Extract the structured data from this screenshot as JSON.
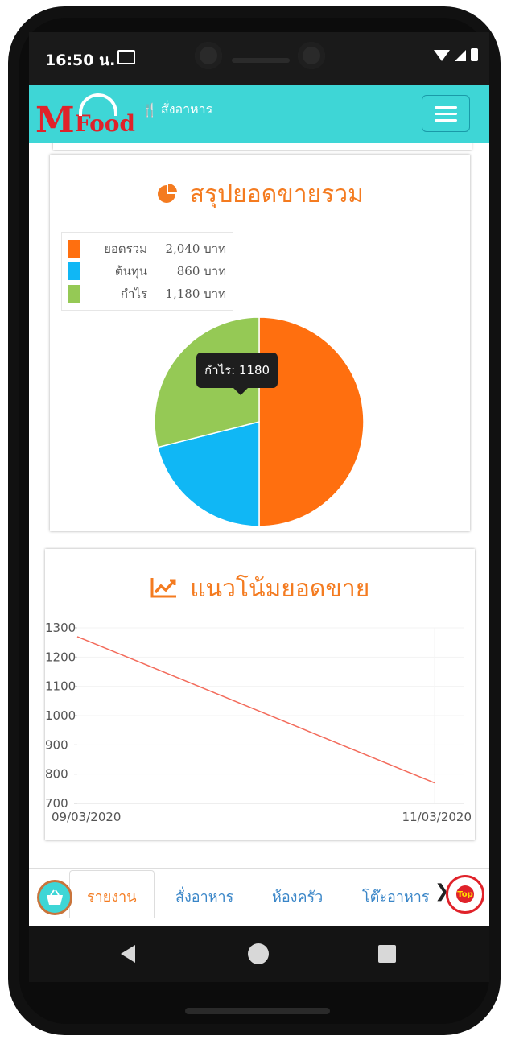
{
  "status_bar": {
    "time": "16:50 น."
  },
  "app_bar": {
    "logo_m": "M",
    "logo_food": "Food",
    "title_icon": "🍴",
    "title": "สั่งอาหาร"
  },
  "summary_card": {
    "icon": "pie-chart-icon",
    "title": "สรุปยอดขายรวม",
    "legend": [
      {
        "name": "ยอดรวม",
        "value": "2,040 บาท",
        "color": "#ff6f0f"
      },
      {
        "name": "ต้นทุน",
        "value": "860 บาท",
        "color": "#10b7f5"
      },
      {
        "name": "กำไร",
        "value": "1,180 บาท",
        "color": "#95c955"
      }
    ],
    "tooltip": "กำไร: 1180"
  },
  "trend_card": {
    "icon": "line-chart-icon",
    "title": "แนวโน้มยอดขาย"
  },
  "chart_data": [
    {
      "type": "pie",
      "labels": [
        "ยอดรวม",
        "ต้นทุน",
        "กำไร"
      ],
      "values": [
        2040,
        860,
        1180
      ],
      "colors": [
        "#ff6f0f",
        "#10b7f5",
        "#95c955"
      ],
      "legend": "top-left"
    },
    {
      "type": "line",
      "x": [
        "09/03/2020",
        "11/03/2020"
      ],
      "series": [
        {
          "values": [
            1270,
            770
          ],
          "color": "#f36b5b"
        }
      ],
      "yticks": [
        1300,
        1200,
        1100,
        1000,
        900,
        800,
        700
      ],
      "ylim": [
        700,
        1300
      ],
      "grid": true
    }
  ],
  "bottom_nav": {
    "items": [
      {
        "label": "รายงาน",
        "active": true,
        "color": "#f47b20"
      },
      {
        "label": "สั่งอาหาร"
      },
      {
        "label": "ห้องครัว"
      },
      {
        "label": "โต๊ะอาหาร"
      }
    ],
    "more_arrow": "❯",
    "top_label": "Top"
  }
}
